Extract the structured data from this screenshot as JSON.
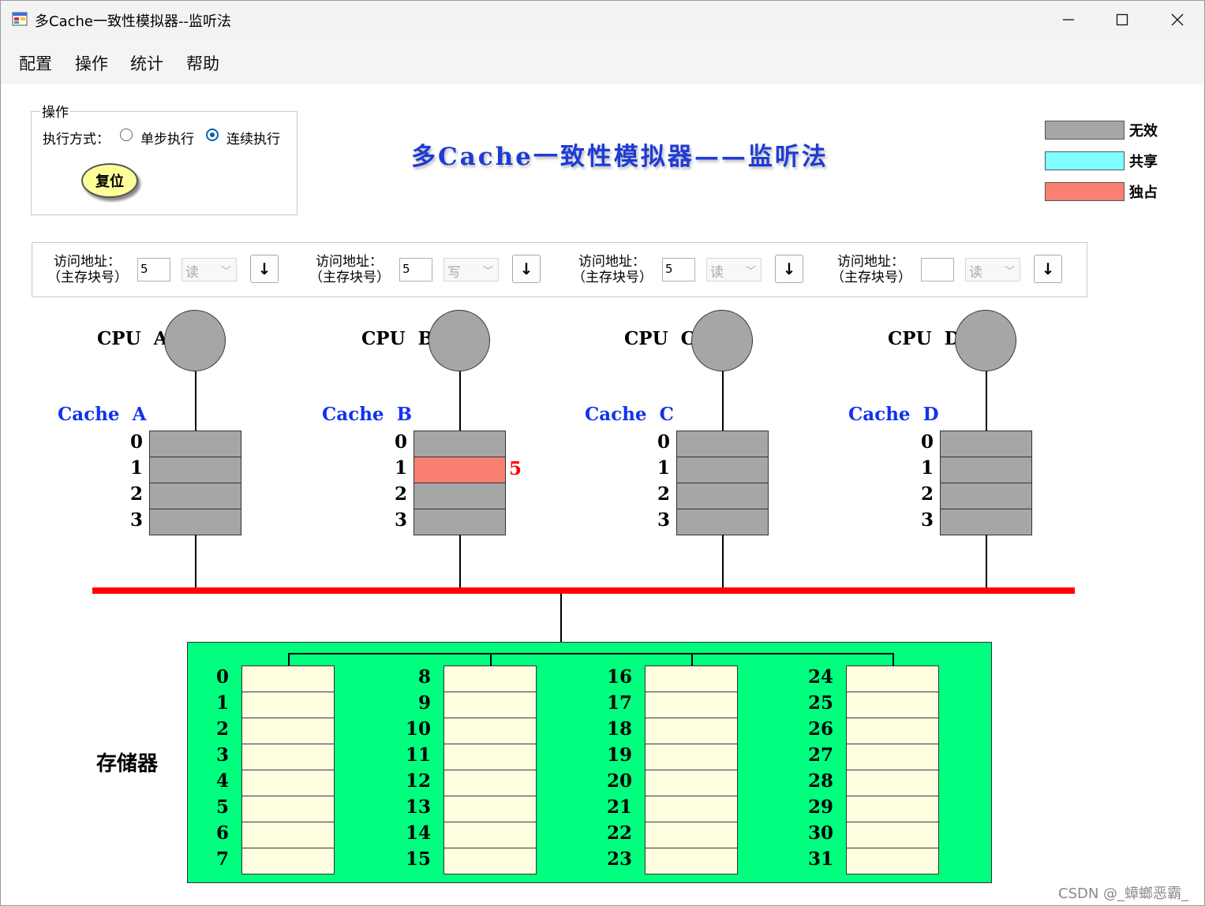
{
  "window": {
    "title": "多Cache一致性模拟器--监听法"
  },
  "menu": [
    "配置",
    "操作",
    "统计",
    "帮助"
  ],
  "operation": {
    "group_title": "操作",
    "exec_label": "执行方式：",
    "modes": [
      {
        "label": "单步执行",
        "selected": false
      },
      {
        "label": "连续执行",
        "selected": true
      }
    ],
    "reset_label": "复位"
  },
  "main_title": "多Cache一致性模拟器——监听法",
  "legend": [
    {
      "label": "无效",
      "color": "#a6a6a6"
    },
    {
      "label": "共享",
      "color": "#80ffff"
    },
    {
      "label": "独占",
      "color": "#fa8072"
    }
  ],
  "access": {
    "label_line1": "访问地址：",
    "label_line2": "（主存块号）",
    "button_icon": "down-arrow-icon",
    "button_glyph": "↓",
    "rows": [
      {
        "address": "5",
        "op": "读"
      },
      {
        "address": "5",
        "op": "写"
      },
      {
        "address": "5",
        "op": "读"
      },
      {
        "address": "",
        "op": "读"
      }
    ]
  },
  "cpus": [
    {
      "cpu_label": "CPU  A",
      "cache_label": "Cache  A",
      "lines": [
        {
          "index": "0",
          "state": "invalid",
          "tag": ""
        },
        {
          "index": "1",
          "state": "invalid",
          "tag": ""
        },
        {
          "index": "2",
          "state": "invalid",
          "tag": ""
        },
        {
          "index": "3",
          "state": "invalid",
          "tag": ""
        }
      ]
    },
    {
      "cpu_label": "CPU  B",
      "cache_label": "Cache  B",
      "lines": [
        {
          "index": "0",
          "state": "invalid",
          "tag": ""
        },
        {
          "index": "1",
          "state": "exclusive",
          "tag": "5"
        },
        {
          "index": "2",
          "state": "invalid",
          "tag": ""
        },
        {
          "index": "3",
          "state": "invalid",
          "tag": ""
        }
      ]
    },
    {
      "cpu_label": "CPU  C",
      "cache_label": "Cache  C",
      "lines": [
        {
          "index": "0",
          "state": "invalid",
          "tag": ""
        },
        {
          "index": "1",
          "state": "invalid",
          "tag": ""
        },
        {
          "index": "2",
          "state": "invalid",
          "tag": ""
        },
        {
          "index": "3",
          "state": "invalid",
          "tag": ""
        }
      ]
    },
    {
      "cpu_label": "CPU  D",
      "cache_label": "Cache  D",
      "lines": [
        {
          "index": "0",
          "state": "invalid",
          "tag": ""
        },
        {
          "index": "1",
          "state": "invalid",
          "tag": ""
        },
        {
          "index": "2",
          "state": "invalid",
          "tag": ""
        },
        {
          "index": "3",
          "state": "invalid",
          "tag": ""
        }
      ]
    }
  ],
  "memory": {
    "label": "存储器",
    "columns": [
      [
        "0",
        "1",
        "2",
        "3",
        "4",
        "5",
        "6",
        "7"
      ],
      [
        "8",
        "9",
        "10",
        "11",
        "12",
        "13",
        "14",
        "15"
      ],
      [
        "16",
        "17",
        "18",
        "19",
        "20",
        "21",
        "22",
        "23"
      ],
      [
        "24",
        "25",
        "26",
        "27",
        "28",
        "29",
        "30",
        "31"
      ]
    ]
  },
  "colors": {
    "bus": "#ff0000",
    "memory_bg": "#00ff7f",
    "memory_block": "#ffffe0",
    "title": "#1f3bd6",
    "cache_label": "#1133ee"
  },
  "watermark": "CSDN @_蟑螂恶霸_"
}
